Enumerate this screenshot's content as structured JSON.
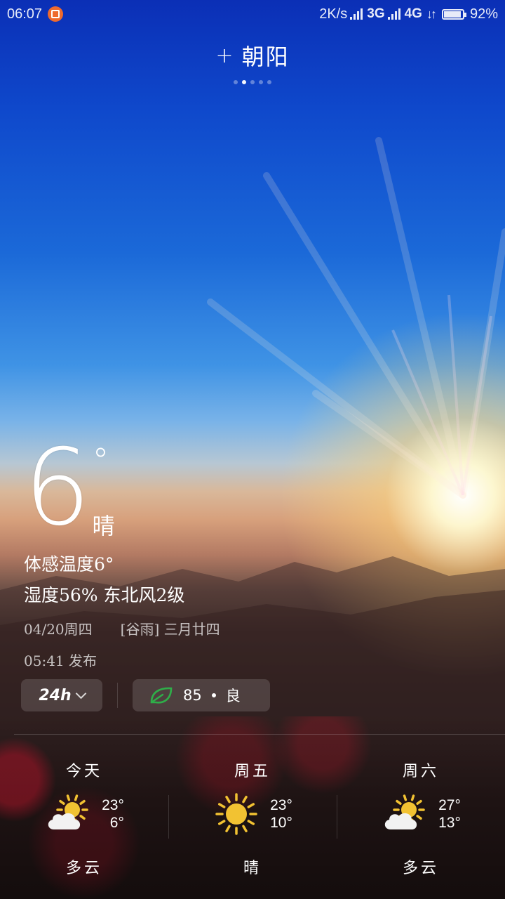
{
  "status_bar": {
    "time": "06:07",
    "net_speed": "2K/s",
    "net_3g": "3G",
    "net_4g": "4G",
    "data_arrows": "↓↑",
    "battery_percent": "92%",
    "battery_level": 0.92
  },
  "header": {
    "add_symbol": "+",
    "city": "朝阳",
    "page_count": 5,
    "active_page": 2
  },
  "current": {
    "temperature": "6",
    "degree": "°",
    "condition": "晴",
    "feels_like": "体感温度6°",
    "humidity_wind": "湿度56%  东北风2级",
    "date": "04/20周四",
    "lunar": "[谷雨] 三月廿四",
    "publish_time": "05:41 发布"
  },
  "controls": {
    "hourly_label": "24h",
    "aqi_value": "85",
    "aqi_level": "良",
    "aqi_color": "#2fae49"
  },
  "forecast": [
    {
      "day": "今天",
      "high": "23°",
      "low": "6°",
      "condition": "多云",
      "icon": "partly-cloudy-icon"
    },
    {
      "day": "周五",
      "high": "23°",
      "low": "10°",
      "condition": "晴",
      "icon": "sunny-icon"
    },
    {
      "day": "周六",
      "high": "27°",
      "low": "13°",
      "condition": "多云",
      "icon": "partly-cloudy-icon"
    }
  ],
  "colors": {
    "sun_icon": "#f2c232",
    "cloud_icon": "#f2f2f2",
    "notification_badge": "#ee6a2e"
  }
}
